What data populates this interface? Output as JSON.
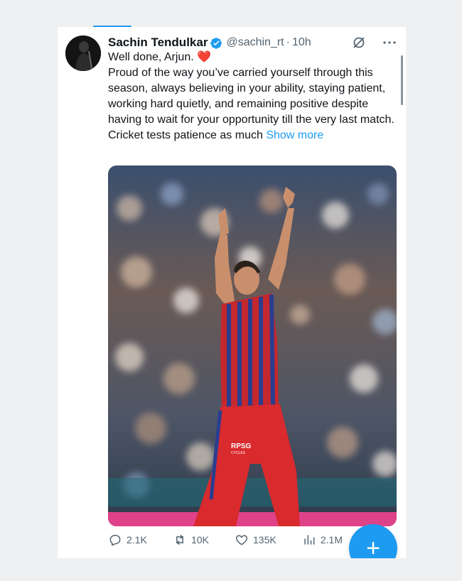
{
  "tweet": {
    "author_name": "Sachin Tendulkar",
    "handle": "@sachin_rt",
    "separator": "·",
    "time": "10h",
    "line1": "Well done, Arjun. ",
    "line2": "Proud of the way you’ve carried yourself through this season, always believing in your ability, staying patient, working hard quietly, and remaining positive despite having to wait for your opportunity till the very last match.",
    "line3": "Cricket tests patience as much ",
    "show_more": "Show more",
    "heart_icon": "red-heart-emoji",
    "media_alt": "Player in red and blue striped jersey celebrating with both arms raised in a stadium"
  },
  "image_text": {
    "sponsor": "RPSG",
    "sponsor_sub": "CYCLES"
  },
  "actions": {
    "replies": "2.1K",
    "reposts": "10K",
    "likes": "135K",
    "views": "2.1M"
  },
  "fab": {
    "label": "+"
  },
  "colors": {
    "accent": "#1d9bf0",
    "text": "#0f1419",
    "muted": "#536471",
    "heart": "#e0245e"
  }
}
